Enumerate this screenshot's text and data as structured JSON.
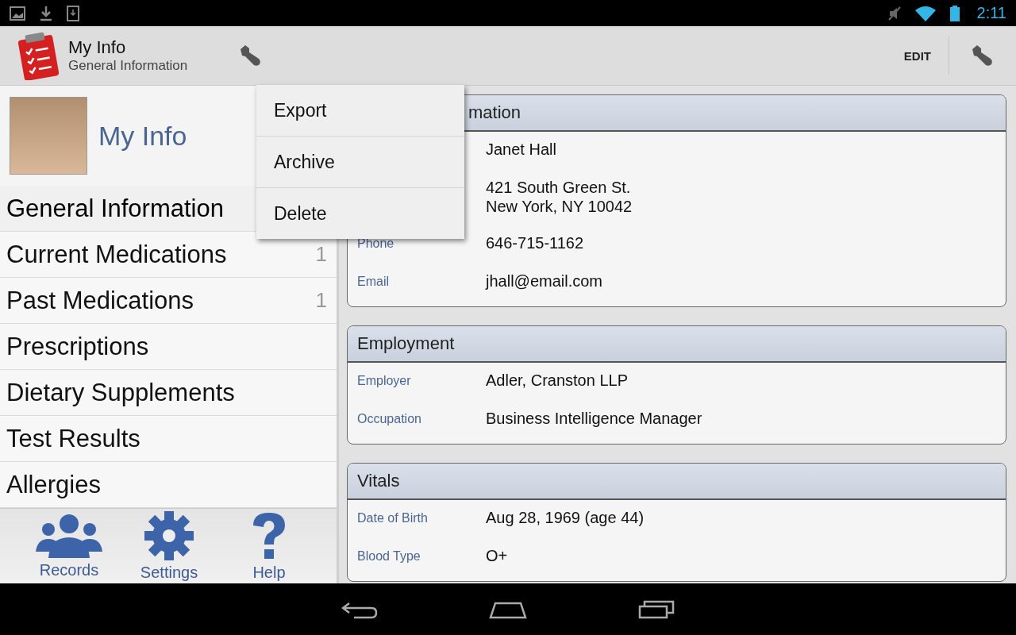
{
  "status_bar": {
    "time": "2:11"
  },
  "action_bar": {
    "title": "My Info",
    "subtitle": "General Information",
    "action": "EDIT"
  },
  "menu": {
    "items": [
      {
        "label": "Export"
      },
      {
        "label": "Archive"
      },
      {
        "label": "Delete"
      }
    ]
  },
  "profile": {
    "name": "My Info"
  },
  "sidebar": {
    "items": [
      {
        "label": "General Information",
        "selected": true
      },
      {
        "label": "Current Medications",
        "count": "1",
        "selected": false
      },
      {
        "label": "Past Medications",
        "count": "1",
        "selected": false
      },
      {
        "label": "Prescriptions",
        "selected": false
      },
      {
        "label": "Dietary Supplements",
        "selected": false
      },
      {
        "label": "Test Results",
        "selected": false
      },
      {
        "label": "Allergies",
        "selected": false
      }
    ]
  },
  "bottom_bar": [
    {
      "kind": "records",
      "label": "Records"
    },
    {
      "kind": "settings",
      "label": "Settings"
    },
    {
      "kind": "help",
      "label": "Help"
    }
  ],
  "sections": [
    {
      "title": "mation",
      "rows": [
        {
          "label": "",
          "value": [
            "Janet Hall"
          ]
        },
        {
          "label": "",
          "value": [
            "421 South Green St.",
            "New York, NY 10042"
          ]
        },
        {
          "label": "Phone",
          "value": [
            "646-715-1162"
          ]
        },
        {
          "label": "Email",
          "value": [
            "jhall@email.com"
          ]
        }
      ]
    },
    {
      "title": "Employment",
      "rows": [
        {
          "label": "Employer",
          "value": [
            "Adler, Cranston LLP"
          ]
        },
        {
          "label": "Occupation",
          "value": [
            "Business Intelligence Manager"
          ]
        }
      ]
    },
    {
      "title": "Vitals",
      "rows": [
        {
          "label": "Date of Birth",
          "value": [
            "Aug 28, 1969 (age 44)"
          ]
        },
        {
          "label": "Blood Type",
          "value": [
            "O+"
          ]
        }
      ]
    }
  ]
}
